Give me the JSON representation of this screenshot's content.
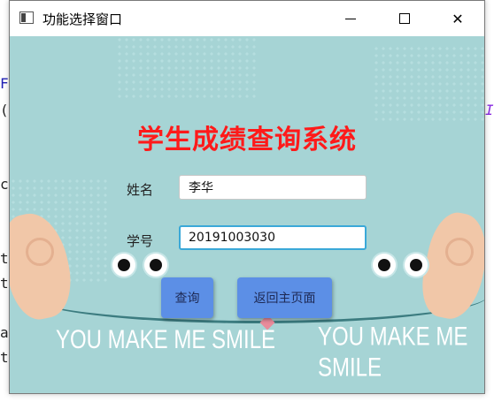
{
  "window": {
    "title": "功能选择窗口",
    "controls": {
      "minimize_icon": "minimize-icon",
      "maximize_icon": "maximize-icon",
      "close_icon": "close-icon",
      "close_glyph": "✕"
    }
  },
  "content": {
    "heading": "学生成绩查询系统",
    "name_label": "姓名",
    "name_value": "李华",
    "id_label": "学号",
    "id_value": "20191003030",
    "query_button": "查询",
    "back_button": "返回主页面",
    "background_text": "YOU MAKE ME SMILE"
  },
  "background_fragments": {
    "left": [
      "F",
      "(",
      "c",
      "t",
      "t",
      "a",
      "t"
    ],
    "right": [
      "I"
    ]
  },
  "colors": {
    "heading": "#ff1a1a",
    "content_bg": "#a6d4d5",
    "button": "#5c8fe6",
    "focus_border": "#3aa8d8"
  }
}
